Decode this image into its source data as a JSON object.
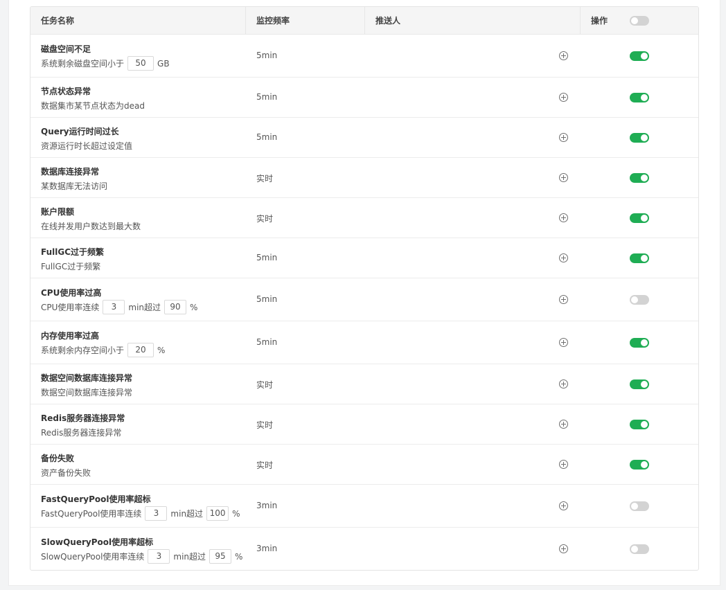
{
  "header": {
    "task_name": "任务名称",
    "frequency": "监控频率",
    "pusher": "推送人",
    "operation": "操作",
    "master_switch": "off"
  },
  "colors": {
    "switch_on": "#1fad54",
    "switch_off": "#d3d3d3"
  },
  "rows": [
    {
      "title": "磁盘空间不足",
      "desc": [
        {
          "t": "系统剩余磁盘空间小于"
        },
        {
          "v": "50",
          "w": 38
        },
        {
          "t": "GB"
        }
      ],
      "freq": "5min",
      "on": true
    },
    {
      "title": "节点状态异常",
      "desc": [
        {
          "t": "数据集市某节点状态为dead"
        }
      ],
      "freq": "5min",
      "on": true
    },
    {
      "title": "Query运行时间过长",
      "desc": [
        {
          "t": "资源运行时长超过设定值"
        }
      ],
      "freq": "5min",
      "on": true
    },
    {
      "title": "数据库连接异常",
      "desc": [
        {
          "t": "某数据库无法访问"
        }
      ],
      "freq": "实时",
      "on": true
    },
    {
      "title": "账户限额",
      "desc": [
        {
          "t": "在线并发用户数达到最大数"
        }
      ],
      "freq": "实时",
      "on": true
    },
    {
      "title": "FullGC过于频繁",
      "desc": [
        {
          "t": "FullGC过于频繁"
        }
      ],
      "freq": "5min",
      "on": true
    },
    {
      "title": "CPU使用率过高",
      "desc": [
        {
          "t": "CPU使用率连续"
        },
        {
          "v": "3",
          "w": 32
        },
        {
          "t": "min超过"
        },
        {
          "v": "90",
          "w": 32
        },
        {
          "t": "%"
        }
      ],
      "freq": "5min",
      "on": false
    },
    {
      "title": "内存使用率过高",
      "desc": [
        {
          "t": "系统剩余内存空间小于"
        },
        {
          "v": "20",
          "w": 38
        },
        {
          "t": "%"
        }
      ],
      "freq": "5min",
      "on": true
    },
    {
      "title": "数据空间数据库连接异常",
      "desc": [
        {
          "t": "数据空间数据库连接异常"
        }
      ],
      "freq": "实时",
      "on": true
    },
    {
      "title": "Redis服务器连接异常",
      "desc": [
        {
          "t": "Redis服务器连接异常"
        }
      ],
      "freq": "实时",
      "on": true
    },
    {
      "title": "备份失败",
      "desc": [
        {
          "t": "资产备份失败"
        }
      ],
      "freq": "实时",
      "on": true
    },
    {
      "title": "FastQueryPool使用率超标",
      "desc": [
        {
          "t": "FastQueryPool使用率连续"
        },
        {
          "v": "3",
          "w": 32
        },
        {
          "t": "min超过"
        },
        {
          "v": "100",
          "w": 32
        },
        {
          "t": "%"
        }
      ],
      "freq": "3min",
      "on": false
    },
    {
      "title": "SlowQueryPool使用率超标",
      "desc": [
        {
          "t": "SlowQueryPool使用率连续"
        },
        {
          "v": "3",
          "w": 32
        },
        {
          "t": "min超过"
        },
        {
          "v": "95",
          "w": 32
        },
        {
          "t": "%"
        }
      ],
      "freq": "3min",
      "on": false
    }
  ]
}
